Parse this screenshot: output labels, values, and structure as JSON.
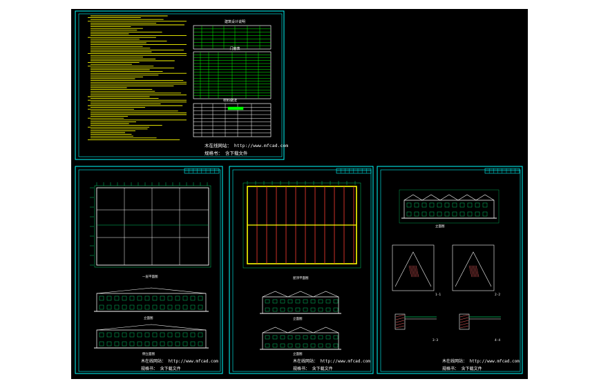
{
  "colors": {
    "canvas": "#000000",
    "frame": "#00ffff",
    "primary": "#ffffff",
    "notes": "#ffff00",
    "table_grid": "#00ff00",
    "highlight": "#ff3b30",
    "detail": "#00cc66",
    "hatch": "#ff6666"
  },
  "sheet1": {
    "watermark": "木在线网站：  http://www.mfcad.com",
    "credit": "规格书：  含下载文件",
    "table1_title": "建筑设计说明",
    "table2_title": "门窗表",
    "table3_title": "材料做法"
  },
  "sheet2": {
    "plan_title": "一层平面图",
    "elev1_title": "立面图",
    "elev2_title": "侧立面图",
    "watermark": "木在线网站：  http://www.mfcad.com",
    "credit": "规格书：  含下载文件"
  },
  "sheet3": {
    "roof_title": "屋顶平面图",
    "elev1_title": "立面图",
    "elev2_title": "立面图",
    "watermark": "木在线网站：  http://www.mfcad.com",
    "credit": "规格书：  含下载文件"
  },
  "sheet4": {
    "elev_title": "立面图",
    "detail_titles": [
      "1-1",
      "2-2",
      "3-3",
      "4-4"
    ],
    "watermark": "木在线网站：  http://www.mfcad.com",
    "credit": "规格书：  含下载文件"
  }
}
